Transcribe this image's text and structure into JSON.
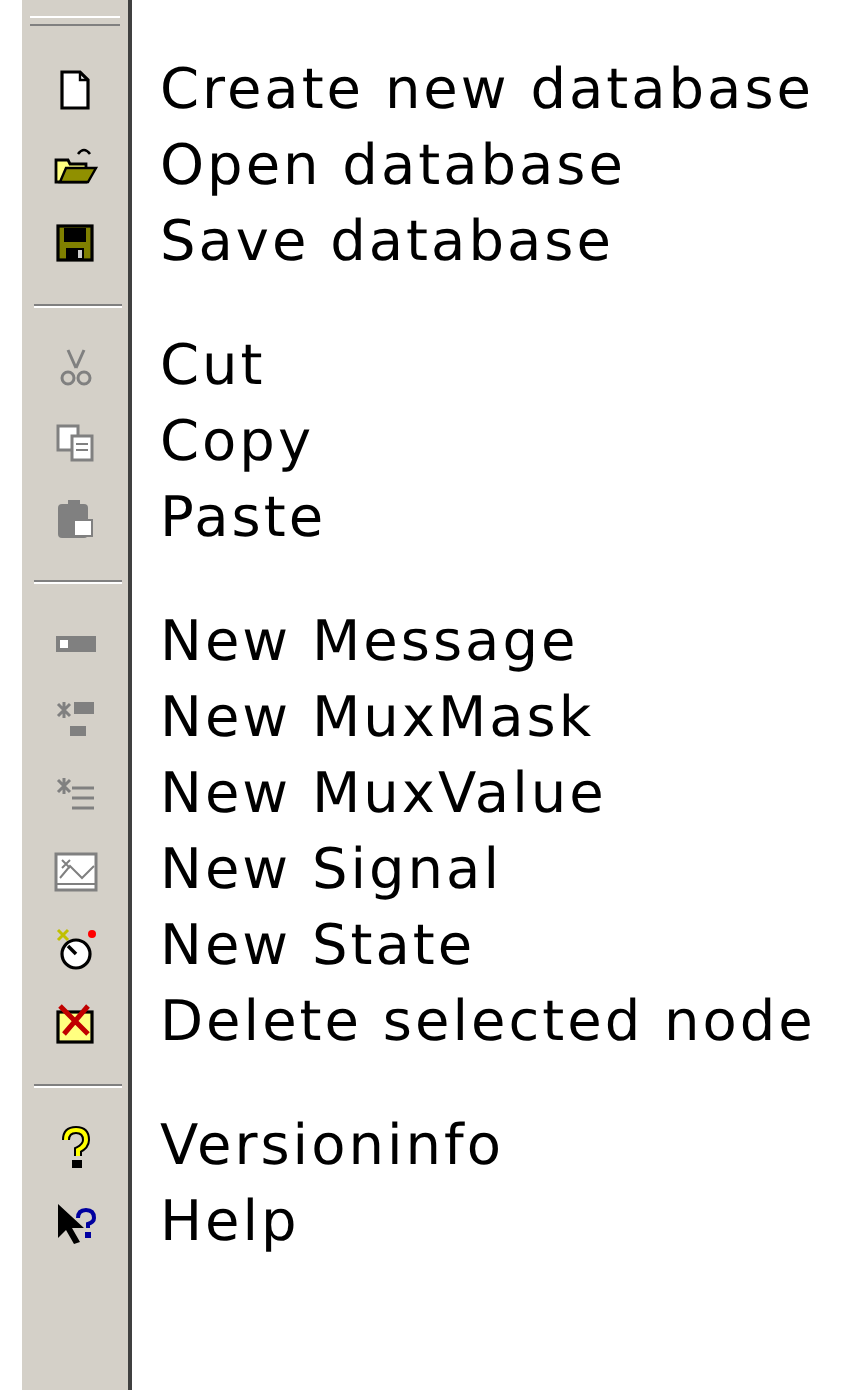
{
  "menu": {
    "groups": [
      {
        "items": [
          {
            "label": "Create new database",
            "disabled": false
          },
          {
            "label": "Open database",
            "disabled": false
          },
          {
            "label": "Save database",
            "disabled": false
          }
        ]
      },
      {
        "items": [
          {
            "label": "Cut",
            "disabled": true
          },
          {
            "label": "Copy",
            "disabled": true
          },
          {
            "label": "Paste",
            "disabled": true
          }
        ]
      },
      {
        "items": [
          {
            "label": "New Message",
            "disabled": true
          },
          {
            "label": "New MuxMask",
            "disabled": true
          },
          {
            "label": "New MuxValue",
            "disabled": true
          },
          {
            "label": "New Signal",
            "disabled": true
          },
          {
            "label": "New State",
            "disabled": false
          },
          {
            "label": "Delete selected node",
            "disabled": false
          }
        ]
      },
      {
        "items": [
          {
            "label": "Versioninfo",
            "disabled": false
          },
          {
            "label": "Help",
            "disabled": false
          }
        ]
      }
    ]
  }
}
